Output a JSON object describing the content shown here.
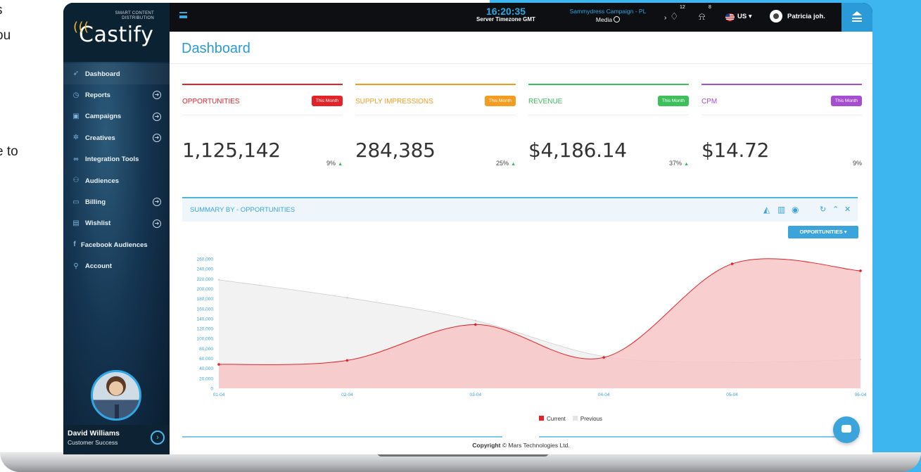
{
  "background_fragment": {
    "lines": [
      "s",
      "ou",
      "e to"
    ]
  },
  "sidebar": {
    "brand_tag_line1": "SMART CONTENT",
    "brand_tag_line2": "DISTRIBUTION",
    "brand_name": "Castify",
    "items": [
      {
        "label": "Dashboard",
        "icon": "rocket-icon",
        "expandable": false
      },
      {
        "label": "Reports",
        "icon": "clock-icon",
        "expandable": true
      },
      {
        "label": "Campaigns",
        "icon": "calendar-icon",
        "expandable": true
      },
      {
        "label": "Creatives",
        "icon": "gear-icon",
        "expandable": true
      },
      {
        "label": "Integration Tools",
        "icon": "link-icon",
        "expandable": false
      },
      {
        "label": "Audiences",
        "icon": "users-icon",
        "expandable": false
      },
      {
        "label": "Billing",
        "icon": "card-icon",
        "expandable": true
      },
      {
        "label": "Wishlist",
        "icon": "list-icon",
        "expandable": true
      },
      {
        "label": "Facebook Audiences",
        "icon": "facebook-icon",
        "expandable": false
      },
      {
        "label": "Account",
        "icon": "user-icon",
        "expandable": false
      }
    ],
    "profile_name": "David Williams",
    "profile_role": "Customer Success"
  },
  "topbar": {
    "time": "16:20:35",
    "timezone": "Server Timezone GMT",
    "campaign": "Sammydress Campaign - PL",
    "media": "Media",
    "bulb_badge": "12",
    "bell_badge": "8",
    "language": "US ▾",
    "user": "Patricia joh."
  },
  "main": {
    "title": "Dashboard",
    "cards": [
      {
        "name": "OPPORTUNITIES",
        "badge": "This Month",
        "value": "1,125,142",
        "pct": "9%",
        "trend": "up",
        "color": "#e2232a"
      },
      {
        "name": "SUPPLY IMPRESSIONS",
        "badge": "This Month",
        "value": "284,385",
        "pct": "25%",
        "trend": "up",
        "color": "#f39c1f"
      },
      {
        "name": "REVENUE",
        "badge": "This Month",
        "value": "$4,186.14",
        "pct": "37%",
        "trend": "up",
        "color": "#3dbf5b"
      },
      {
        "name": "CPM",
        "badge": "This Month",
        "value": "$14.72",
        "pct": "9%",
        "trend": "none",
        "color": "#a64ed1"
      }
    ],
    "summary_title": "SUMMARY BY - OPPORTUNITIES",
    "dropdown_label": "OPPORTUNITIES ▾",
    "copyright_label": "Copyright",
    "copyright_text": "© Mars Technologies Ltd."
  },
  "chart_data": {
    "type": "area",
    "x": [
      "01-04",
      "02-04",
      "03-04",
      "04-04",
      "05-04",
      "06-04"
    ],
    "ylim": [
      0,
      260000
    ],
    "yticks": [
      0,
      20000,
      40000,
      60000,
      80000,
      100000,
      120000,
      140000,
      160000,
      180000,
      200000,
      220000,
      240000,
      260000
    ],
    "series": [
      {
        "name": "Current",
        "color": "#e2232a",
        "fill": "#f7c6c6",
        "values": [
          48000,
          56000,
          128000,
          62000,
          250000,
          236000
        ]
      },
      {
        "name": "Previous",
        "color": "#cccccc",
        "fill": "#ececec",
        "values": [
          218000,
          182000,
          136000,
          64000,
          52000,
          58000
        ]
      }
    ]
  }
}
